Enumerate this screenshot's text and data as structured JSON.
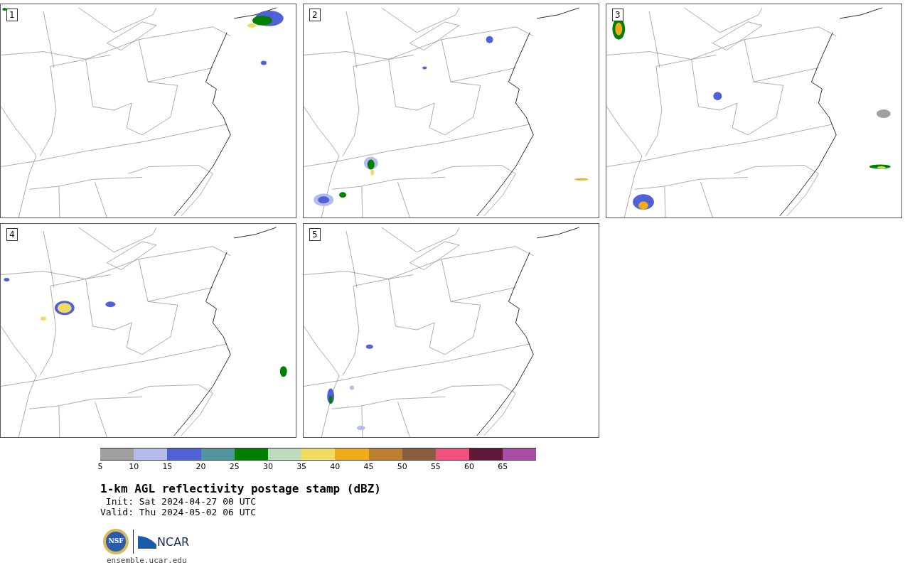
{
  "panels": [
    {
      "label": "1"
    },
    {
      "label": "2"
    },
    {
      "label": "3"
    },
    {
      "label": "4"
    },
    {
      "label": "5"
    }
  ],
  "colorbar": {
    "bins": [
      {
        "color": "#a0a0a0"
      },
      {
        "color": "#b4bcec"
      },
      {
        "color": "#5060d8"
      },
      {
        "color": "#50969c"
      },
      {
        "color": "#008000"
      },
      {
        "color": "#bcdcbc"
      },
      {
        "color": "#f0dc60"
      },
      {
        "color": "#f0ac18"
      },
      {
        "color": "#bc8030"
      },
      {
        "color": "#8c5c40"
      },
      {
        "color": "#f4507c"
      },
      {
        "color": "#641838"
      },
      {
        "color": "#ac4ca4"
      }
    ],
    "ticks": [
      "5",
      "10",
      "15",
      "20",
      "25",
      "30",
      "35",
      "40",
      "45",
      "50",
      "55",
      "60",
      "65"
    ]
  },
  "title": "1-km AGL reflectivity postage stamp (dBZ)",
  "init": " Init: Sat 2024-04-27 00 UTC",
  "valid": "Valid: Thu 2024-05-02 06 UTC",
  "logo": {
    "seal_text": "NSF",
    "wordmark": "NCAR"
  },
  "footer": "ensemble.ucar.edu"
}
